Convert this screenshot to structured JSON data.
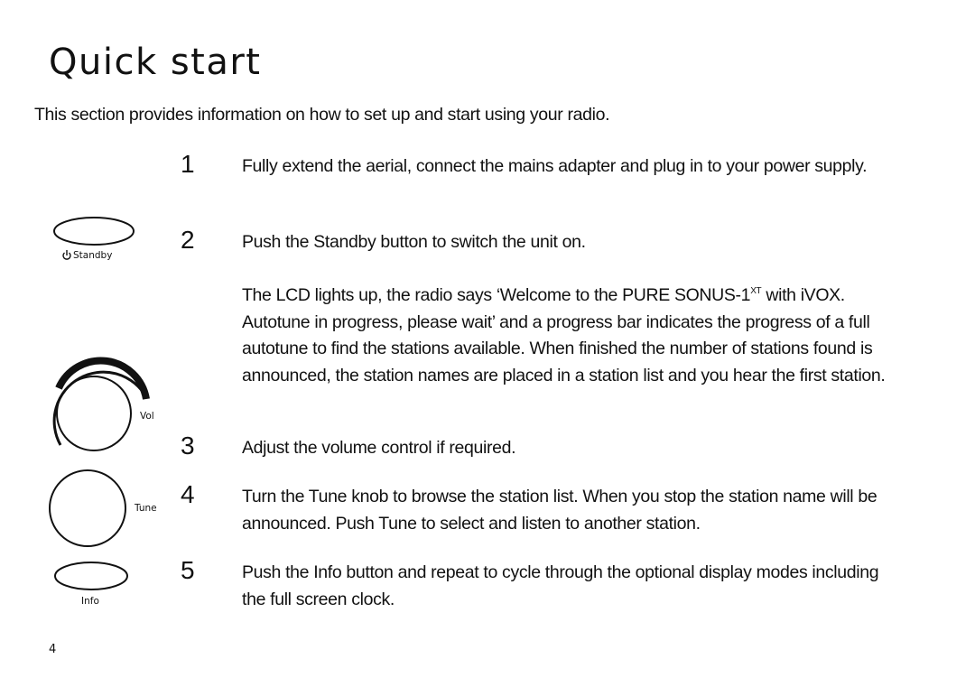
{
  "title": "Quick start",
  "intro": "This section provides information on how to set up and start using your radio.",
  "steps": [
    {
      "number": "1",
      "text": "Fully extend the aerial, connect the mains adapter and plug in to your power supply."
    },
    {
      "number": "2",
      "text": "Push the Standby button to switch the unit on."
    },
    {
      "number": "3",
      "text": "Adjust the volume control if required."
    },
    {
      "number": "4",
      "text": "Turn the Tune knob to browse the station list. When you stop the station name will be announced. Push Tune to select and listen to another station."
    },
    {
      "number": "5",
      "text": "Push the Info button and repeat to cycle through the optional display modes including the full screen clock."
    }
  ],
  "step2_detail": {
    "before": "The LCD lights up, the radio says ‘Welcome to the PURE SONUS-1",
    "superscript": "XT",
    "after": " with iVOX. Autotune in progress, please wait’ and a progress bar indicates the progress of a full autotune to find the stations available. When finished the number of stations found is announced, the station names are placed in a station list and you hear the first station."
  },
  "controls": {
    "standby": "Standby",
    "vol": "Vol",
    "tune": "Tune",
    "info": "Info",
    "power_icon": "power-icon"
  },
  "page_number": "4"
}
